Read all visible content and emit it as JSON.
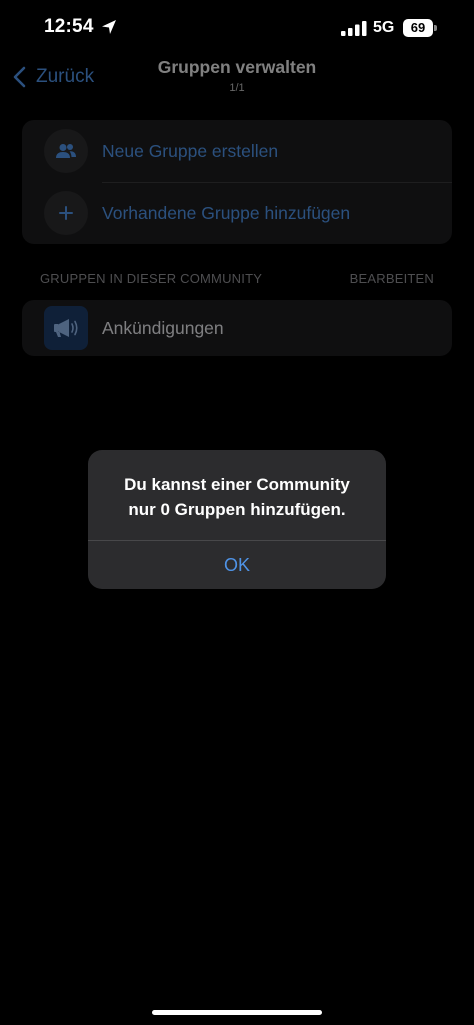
{
  "status_bar": {
    "time": "12:54",
    "network": "5G",
    "battery": "69"
  },
  "nav": {
    "back_label": "Zurück",
    "title": "Gruppen verwalten",
    "subtitle": "1/1"
  },
  "actions": [
    {
      "label": "Neue Gruppe erstellen",
      "icon": "people-icon"
    },
    {
      "label": "Vorhandene Gruppe hinzufügen",
      "icon": "plus-icon"
    }
  ],
  "section": {
    "header": "GRUPPEN IN DIESER COMMUNITY",
    "edit_label": "BEARBEITEN"
  },
  "groups": [
    {
      "label": "Ankündigungen",
      "icon": "megaphone-icon"
    }
  ],
  "alert": {
    "line1": "Du kannst einer Community",
    "line2": "nur 0 Gruppen hinzufügen.",
    "ok_label": "OK"
  },
  "colors": {
    "accent": "#4f93e6",
    "card": "#1c1c1e",
    "alert": "#2c2c2e"
  }
}
